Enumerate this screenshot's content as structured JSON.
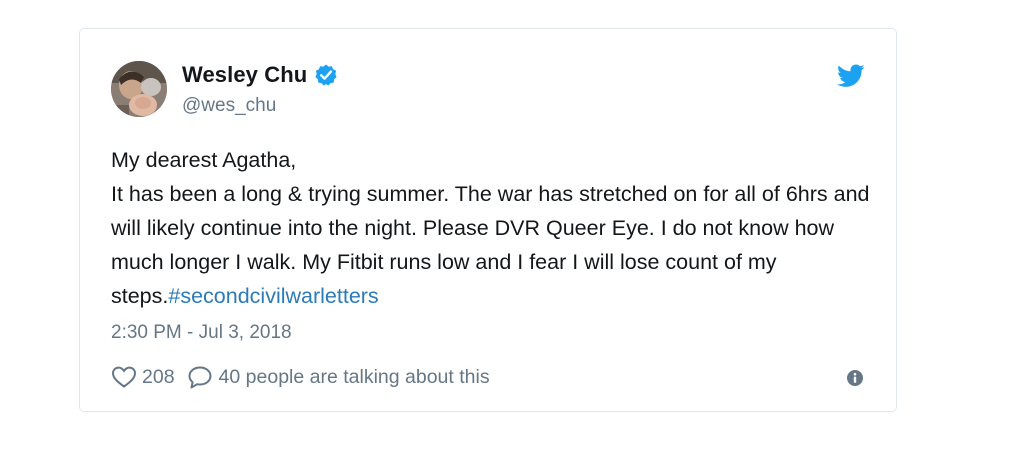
{
  "author": {
    "name": "Wesley Chu",
    "handle": "@wes_chu"
  },
  "tweet": {
    "body": "My dearest Agatha,\nIt has been a long & trying summer. The war has stretched on for all of 6hrs and will likely continue into the night. Please DVR Queer Eye. I do not know how much longer I walk. My Fitbit runs low and I fear I will lose count of my steps.",
    "hashtag": "#secondcivilwarletters",
    "timestamp": "2:30 PM - Jul 3, 2018"
  },
  "actions": {
    "likes": "208",
    "talking": "40 people are talking about this"
  },
  "icons": {
    "brand": "twitter-bird-icon",
    "verified": "verified-badge-icon",
    "like": "heart-icon",
    "reply": "speech-bubble-icon",
    "info": "info-icon"
  },
  "colors": {
    "brand_blue": "#1da1f2",
    "link_blue": "#2b7bb9",
    "secondary_text": "#657786",
    "primary_text": "#14171a",
    "border": "#e1e8ed"
  }
}
